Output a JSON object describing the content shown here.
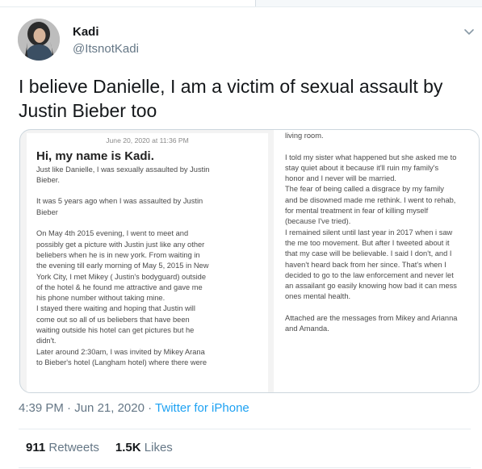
{
  "author": {
    "name": "Kadi",
    "handle": "@ItsnotKadi"
  },
  "tweet": {
    "text": "I believe Danielle, I am a victim of sexual assault by Justin Bieber too",
    "time": "4:39 PM",
    "date": "Jun 21, 2020",
    "separator": "·",
    "source": "Twitter for iPhone"
  },
  "stats": {
    "retweets_count": "911",
    "retweets_label": "Retweets",
    "likes_count": "1.5K",
    "likes_label": "Likes"
  },
  "media": {
    "left_note": {
      "date": "June 20, 2020 at 11:36 PM",
      "heading": "Hi, my name is Kadi.",
      "body": "Just like Danielle, I was sexually assaulted by Justin\nBieber.\n\nIt was 5 years ago when I was assaulted by Justin\nBieber\n\nOn May 4th 2015 evening, I went to meet and\npossibly get a picture with Justin just like any other\nbeliebers when he is in new york. From waiting in\nthe evening till early morning of May 5, 2015 in New\nYork City, I met Mikey ( Justin's bodyguard) outside\nof the hotel & he found me attractive and gave me\nhis phone number without taking mine.\nI stayed there waiting and hoping that Justin will\ncome out so all of us beliebers that have been\nwaiting outside his hotel can get pictures but he\ndidn't.\nLater around 2:30am, I was invited by Mikey Arana\nto Bieber's hotel (Langham hotel) where there were"
    },
    "right_note": {
      "body": "living room.\n\nI told my sister what happened but she asked me to\nstay quiet about it because it'll ruin my family's\nhonor and I never will be married.\nThe fear of being called a disgrace by my family\nand be disowned made me rethink. I went to rehab,\nfor mental treatment in fear of killing myself\n(because I've tried).\nI remained silent until last year in 2017 when i saw\nthe me too movement. But after I tweeted about it\nthat my case will be believable. I said I don't, and I\nhaven't heard back from her since. That's when I\ndecided to go to the law enforcement and never let\nan assailant go easily knowing how bad it can mess\nones mental health.\n\nAttached are the messages from Mikey and Arianna\nand Amanda."
    }
  },
  "icons": {
    "more": "chevron-down-icon",
    "avatar": "avatar-photo"
  },
  "colors": {
    "link": "#1da1f2",
    "muted": "#657786",
    "text": "#14171a",
    "border": "#e6ecf0"
  }
}
